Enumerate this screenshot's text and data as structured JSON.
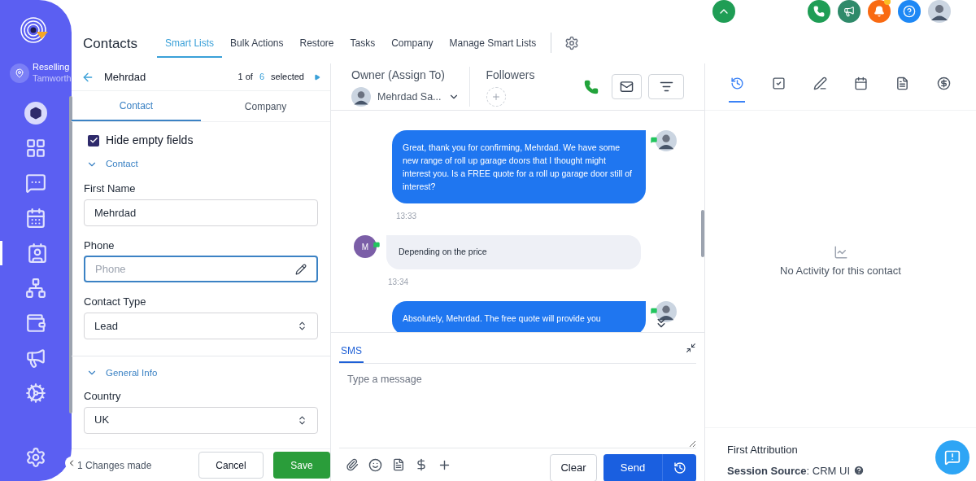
{
  "sidebar": {
    "location": {
      "name": "Reselling",
      "city": "Tamworth"
    },
    "items": [
      {
        "selected": false,
        "kind": "launchpad"
      },
      {
        "selected": false,
        "kind": "dashboard"
      },
      {
        "selected": false,
        "kind": "chat"
      },
      {
        "selected": false,
        "kind": "calendar"
      },
      {
        "selected": true,
        "kind": "contacts"
      },
      {
        "selected": false,
        "kind": "network"
      },
      {
        "selected": false,
        "kind": "wallet"
      },
      {
        "selected": false,
        "kind": "megaphone"
      },
      {
        "selected": false,
        "kind": "automation"
      }
    ]
  },
  "header": {
    "title": "Contacts",
    "tabs": [
      {
        "label": "Smart Lists",
        "selected": true
      },
      {
        "label": "Bulk Actions",
        "selected": false
      },
      {
        "label": "Restore",
        "selected": false
      },
      {
        "label": "Tasks",
        "selected": false
      },
      {
        "label": "Company",
        "selected": false
      },
      {
        "label": "Manage Smart Lists",
        "selected": false
      }
    ]
  },
  "top_actions": [
    {
      "kind": "up"
    },
    {
      "kind": "phone"
    },
    {
      "kind": "megaphone"
    },
    {
      "kind": "bell",
      "has_notification": true
    },
    {
      "kind": "help"
    },
    {
      "kind": "avatar"
    }
  ],
  "contact_panel": {
    "name": "Mehrdad",
    "position": "1 of",
    "count": "6",
    "selected_label": "selected",
    "tabs": [
      {
        "label": "Contact",
        "selected": true
      },
      {
        "label": "Company",
        "selected": false
      }
    ],
    "hide_empty": {
      "label": "Hide empty fields",
      "checked": true
    },
    "sections": [
      {
        "title": "Contact",
        "expanded": true,
        "fields": [
          {
            "kind": "text",
            "label": "First Name",
            "value": "Mehrdad",
            "focused": false
          },
          {
            "kind": "text",
            "label": "Phone",
            "placeholder": "Phone",
            "focused": true
          },
          {
            "kind": "select",
            "label": "Contact Type",
            "value": "Lead",
            "focused": false
          }
        ]
      },
      {
        "title": "General Info",
        "expanded": true,
        "fields": [
          {
            "kind": "select",
            "label": "Country",
            "value": "UK",
            "focused": false
          }
        ]
      }
    ],
    "footer": {
      "changes": "1 Changes made",
      "cancel": "Cancel",
      "save": "Save"
    }
  },
  "conversation": {
    "owner_label": "Owner (Assign To)",
    "owner": "Mehrdad Sa...",
    "followers_label": "Followers",
    "messages": [
      {
        "kind": "outbound",
        "text": "Great, thank you for confirming, Mehrdad. We have some new range of roll up garage doors that I thought might interest you. Is a FREE quote for a roll up garage door still of interest?",
        "time": "13:33"
      },
      {
        "kind": "inbound",
        "initial": "M",
        "text": "Depending on the price",
        "time": "13:34"
      },
      {
        "kind": "outbound",
        "text": "Absolutely, Mehrdad. The free quote will provide you"
      }
    ],
    "composer": {
      "tab": "SMS",
      "placeholder": "Type a message",
      "clear": "Clear",
      "send": "Send"
    }
  },
  "activity": {
    "tabs": [
      {
        "selected": true
      },
      {
        "selected": false
      },
      {
        "selected": false
      },
      {
        "selected": false
      },
      {
        "selected": false
      },
      {
        "selected": false
      }
    ],
    "empty": "No Activity for this contact",
    "attribution_title": "First Attribution",
    "source_label": "Session Source",
    "source_value": ": CRM UI"
  }
}
